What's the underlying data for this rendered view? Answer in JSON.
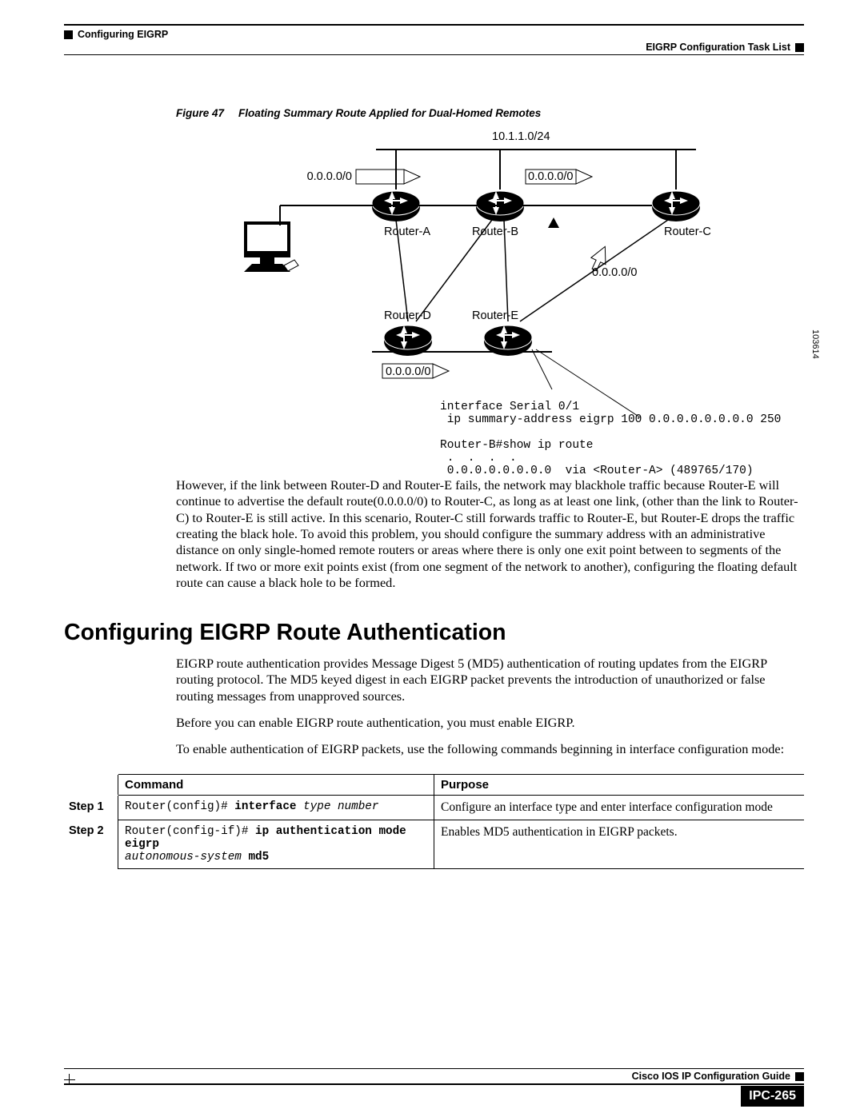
{
  "header": {
    "left": "Configuring EIGRP",
    "right": "EIGRP Configuration Task List"
  },
  "figure": {
    "label": "Figure 47",
    "title": "Floating Summary Route Applied for Dual-Homed Remotes",
    "top_net": "10.1.1.0/24",
    "zero_a": "0.0.0.0/0",
    "zero_b": "0.0.0.0/0",
    "zero_c": "0.0.0.0/0",
    "zero_d": "0.0.0.0/0",
    "ra": "Router-A",
    "rb": "Router-B",
    "rc": "Router-C",
    "rd": "Router-D",
    "re": "Router-E",
    "code_id": "103614",
    "cli1": "interface Serial 0/1",
    "cli2": " ip summary-address eigrp 100 0.0.0.0.0.0.0.0 250",
    "cli3": "Router-B#show ip route",
    "cli4": " .  .  .  .",
    "cli5": " 0.0.0.0.0.0.0.0  via <Router-A> (489765/170)"
  },
  "body1": "However, if the link between Router-D and Router-E fails, the network may blackhole traffic because Router-E will continue to advertise the default route(0.0.0.0/0) to Router-C, as long as at least one link, (other than the link to Router-C) to Router-E is still active. In this scenario, Router-C still forwards traffic to Router-E, but Router-E drops the traffic creating the black hole. To avoid this problem, you should configure the summary address with an administrative distance on only single-homed remote routers or areas where there is only one exit point between to segments of the network. If two or more exit points exist (from one segment of the network to another), configuring the floating default route can cause a black hole to be formed.",
  "section": "Configuring EIGRP Route Authentication",
  "para1": "EIGRP route authentication provides Message Digest 5 (MD5) authentication of routing updates from the EIGRP routing protocol. The MD5 keyed digest in each EIGRP packet prevents the introduction of unauthorized or false routing messages from unapproved sources.",
  "para2": "Before you can enable EIGRP route authentication, you must enable EIGRP.",
  "para3": "To enable authentication of EIGRP packets, use the following commands beginning in interface configuration mode:",
  "table": {
    "h1": "Command",
    "h2": "Purpose",
    "rows": [
      {
        "step": "Step 1",
        "cmd_prefix": "Router(config)# ",
        "cmd_bold": "interface",
        "cmd_italic": " type number",
        "cmd_suffix": "",
        "purpose": "Configure an interface type and enter interface configuration mode"
      },
      {
        "step": "Step 2",
        "cmd_prefix": "Router(config-if)# ",
        "cmd_bold": "ip authentication mode eigrp",
        "cmd_italic": "\nautonomous-system ",
        "cmd_suffix": "md5",
        "purpose": "Enables MD5 authentication in EIGRP packets."
      }
    ]
  },
  "footer": {
    "guide": "Cisco IOS IP Configuration Guide",
    "page": "IPC-265"
  }
}
